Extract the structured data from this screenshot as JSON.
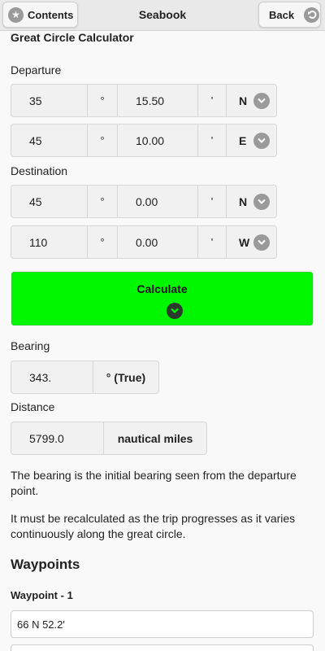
{
  "header": {
    "contents_label": "Contents",
    "title": "Seabook",
    "back_label": "Back",
    "contents_icon": "star-icon",
    "back_icon": "back-arrow-icon"
  },
  "calculator": {
    "title": "Great Circle Calculator",
    "departure_label": "Departure",
    "destination_label": "Destination",
    "degree_symbol": "°",
    "minute_symbol": "'",
    "departure": {
      "lat": {
        "deg": "35",
        "min": "15.50",
        "hemi": "N"
      },
      "lon": {
        "deg": "45",
        "min": "10.00",
        "hemi": "E"
      }
    },
    "destination": {
      "lat": {
        "deg": "45",
        "min": "0.00",
        "hemi": "N"
      },
      "lon": {
        "deg": "110",
        "min": "0.00",
        "hemi": "W"
      }
    },
    "calculate_label": "Calculate",
    "calculate_color": "#00f700"
  },
  "results": {
    "bearing_label": "Bearing",
    "bearing_value": "343.",
    "bearing_unit": "° (True)",
    "distance_label": "Distance",
    "distance_value": "5799.0",
    "distance_unit": "nautical miles"
  },
  "notes": {
    "p1": "The bearing is the initial bearing seen from the departure point.",
    "p2": "It must be recalculated as the trip progresses as it varies continuously along the great circle."
  },
  "waypoints": {
    "heading": "Waypoints",
    "items": [
      {
        "title": "Waypoint - 1",
        "value": "66 N  52.2'"
      }
    ]
  }
}
